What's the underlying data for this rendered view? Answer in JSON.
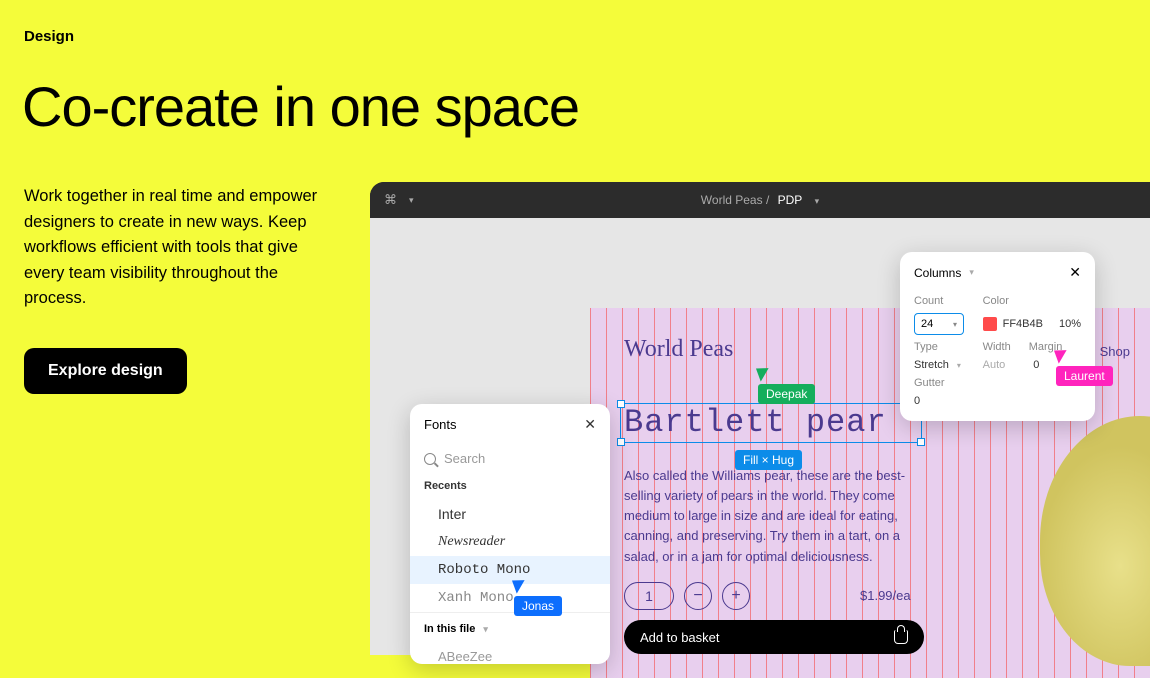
{
  "page": {
    "label": "Design",
    "headline": "Co-create in one space",
    "body": "Work together in real time and empower designers to create in new ways. Keep workflows efficient with tools that give every team visibility throughout the process.",
    "cta": "Explore design"
  },
  "app": {
    "breadcrumb": {
      "project": "World Peas",
      "page": "PDP"
    }
  },
  "artboard": {
    "brand": "World Peas",
    "nav_shop": "Shop",
    "product_title": "Bartlett pear",
    "selection_badge": "Fill × Hug",
    "description": "Also called the Williams pear, these are the best-selling variety of pears in the world. They come medium to large in size and are ideal for eating, canning, and preserving. Try them in a tart, on a salad, or in a jam for optimal deliciousness.",
    "qty": "1",
    "minus": "−",
    "plus": "+",
    "price": "$1.99/ea",
    "basket": "Add to basket"
  },
  "fonts_panel": {
    "title": "Fonts",
    "search_placeholder": "Search",
    "section_recents": "Recents",
    "items": {
      "inter": "Inter",
      "newsreader": "Newsreader",
      "roboto_mono": "Roboto Mono",
      "xanh_mono": "Xanh Mono"
    },
    "section_file": "In this file",
    "extra": "ABeeZee"
  },
  "columns_panel": {
    "title": "Columns",
    "labels": {
      "count": "Count",
      "color": "Color",
      "type": "Type",
      "width": "Width",
      "margin": "Margin",
      "gutter": "Gutter"
    },
    "count": "24",
    "color_hex": "FF4B4B",
    "color_alpha": "10%",
    "type": "Stretch",
    "width": "Auto",
    "margin": "0",
    "gutter": "0"
  },
  "cursors": {
    "deepak": "Deepak",
    "jonas": "Jonas",
    "laurent": "Laurent"
  }
}
